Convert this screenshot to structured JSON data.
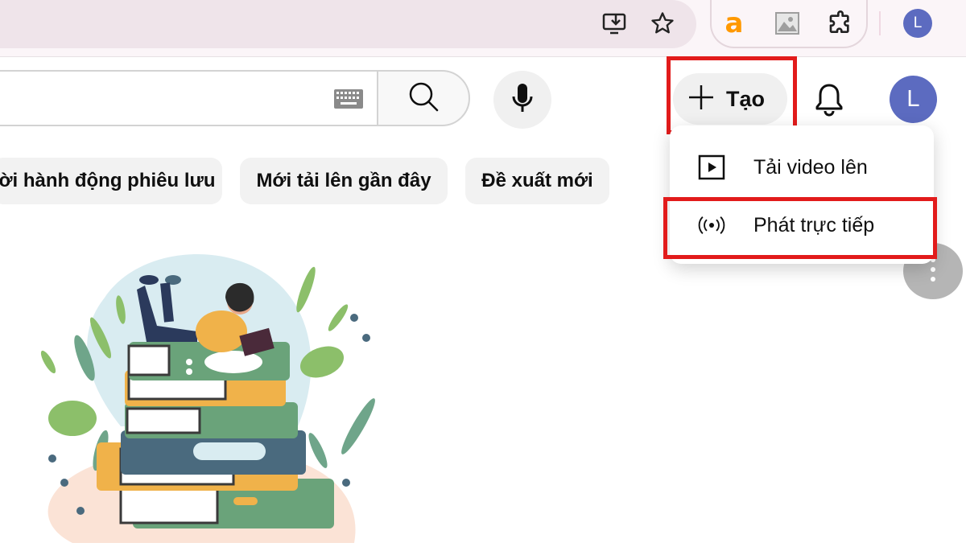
{
  "browser": {
    "toolbar_icons": [
      "install-app-icon",
      "bookmark-star-icon"
    ],
    "extensions": [
      "amazon-assistant-icon",
      "image-extension-icon",
      "extensions-puzzle-icon"
    ],
    "profile_initial": "L",
    "profile_color": "#5c6bc0"
  },
  "header": {
    "search_placeholder": "",
    "create_label": "Tạo",
    "avatar_initial": "L",
    "avatar_color": "#5c6bc0"
  },
  "chips": [
    {
      "label": "ời hành động phiêu lưu"
    },
    {
      "label": "Mới tải lên gần đây"
    },
    {
      "label": "Đề xuất mới"
    }
  ],
  "create_menu": {
    "items": [
      {
        "label": "Tải video lên",
        "icon": "upload-video-icon"
      },
      {
        "label": "Phát trực tiếp",
        "icon": "live-broadcast-icon"
      }
    ]
  },
  "colors": {
    "highlight": "#e21b1b",
    "chip_bg": "#f2f2f2"
  }
}
